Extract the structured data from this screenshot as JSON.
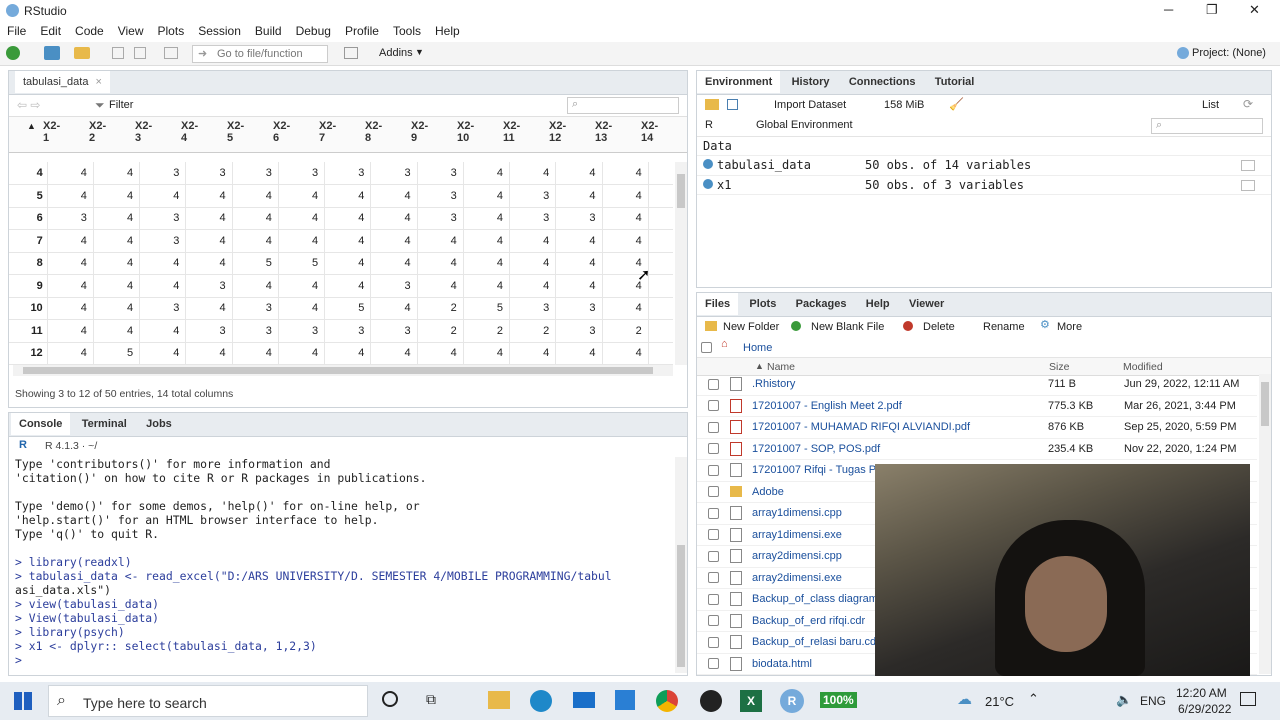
{
  "window": {
    "title": "RStudio",
    "minimize": "─",
    "restore": "❐",
    "close": "✕"
  },
  "menu": [
    "File",
    "Edit",
    "Code",
    "View",
    "Plots",
    "Session",
    "Build",
    "Debug",
    "Profile",
    "Tools",
    "Help"
  ],
  "toolbar": {
    "goto_placeholder": "Go to file/function",
    "addins": "Addins",
    "project": "Project: (None)"
  },
  "source": {
    "tab": "tabulasi_data",
    "filter": "Filter",
    "columns": [
      "X2-\n1",
      "X2-\n2",
      "X2-\n3",
      "X2-\n4",
      "X2-\n5",
      "X2-\n6",
      "X2-\n7",
      "X2-\n8",
      "X2-\n9",
      "X2-\n10",
      "X2-\n11",
      "X2-\n12",
      "X2-\n13",
      "X2-\n14"
    ],
    "rows": [
      {
        "n": "4",
        "v": [
          "4",
          "4",
          "3",
          "3",
          "3",
          "3",
          "3",
          "3",
          "3",
          "4",
          "4",
          "4",
          "4",
          "4"
        ]
      },
      {
        "n": "5",
        "v": [
          "4",
          "4",
          "4",
          "4",
          "4",
          "4",
          "4",
          "4",
          "3",
          "4",
          "3",
          "4",
          "4",
          "3"
        ]
      },
      {
        "n": "6",
        "v": [
          "3",
          "4",
          "3",
          "4",
          "4",
          "4",
          "4",
          "4",
          "3",
          "4",
          "3",
          "3",
          "4",
          "3"
        ]
      },
      {
        "n": "7",
        "v": [
          "4",
          "4",
          "3",
          "4",
          "4",
          "4",
          "4",
          "4",
          "4",
          "4",
          "4",
          "4",
          "4",
          "4"
        ]
      },
      {
        "n": "8",
        "v": [
          "4",
          "4",
          "4",
          "4",
          "5",
          "5",
          "4",
          "4",
          "4",
          "4",
          "4",
          "4",
          "4",
          "4"
        ]
      },
      {
        "n": "9",
        "v": [
          "4",
          "4",
          "4",
          "3",
          "4",
          "4",
          "4",
          "3",
          "4",
          "4",
          "4",
          "4",
          "4",
          "3"
        ]
      },
      {
        "n": "10",
        "v": [
          "4",
          "4",
          "3",
          "4",
          "3",
          "4",
          "5",
          "4",
          "2",
          "5",
          "3",
          "3",
          "4",
          "3"
        ]
      },
      {
        "n": "11",
        "v": [
          "4",
          "4",
          "4",
          "3",
          "3",
          "3",
          "3",
          "3",
          "2",
          "2",
          "2",
          "3",
          "2",
          "3"
        ]
      },
      {
        "n": "12",
        "v": [
          "4",
          "5",
          "4",
          "4",
          "4",
          "4",
          "4",
          "4",
          "4",
          "4",
          "4",
          "4",
          "4",
          "3"
        ]
      }
    ],
    "status": "Showing 3 to 12 of 50 entries, 14 total columns"
  },
  "console": {
    "tabs": [
      "Console",
      "Terminal",
      "Jobs"
    ],
    "version": "R 4.1.3 · ~/",
    "lines": [
      "Type 'contributors()' for more information and",
      "'citation()' on how to cite R or R packages in publications.",
      "",
      "Type 'demo()' for some demos, 'help()' for on-line help, or",
      "'help.start()' for an HTML browser interface to help.",
      "Type 'q()' to quit R.",
      "",
      "> library(readxl)",
      "> tabulasi_data <- read_excel(\"D:/ARS UNIVERSITY/D. SEMESTER 4/MOBILE PROGRAMMING/tabul",
      "asi_data.xls\")",
      "> view(tabulasi_data)",
      "> View(tabulasi_data)",
      "> library(psych)",
      "> x1 <- dplyr:: select(tabulasi_data, 1,2,3)",
      ">"
    ]
  },
  "env": {
    "tabs": [
      "Environment",
      "History",
      "Connections",
      "Tutorial"
    ],
    "import": "Import Dataset",
    "memory": "158 MiB",
    "list": "List",
    "lang": "R",
    "scope": "Global Environment",
    "section": "Data",
    "items": [
      {
        "name": "tabulasi_data",
        "desc": "50 obs. of 14 variables"
      },
      {
        "name": "x1",
        "desc": "50 obs. of 3 variables"
      }
    ]
  },
  "files": {
    "tabs": [
      "Files",
      "Plots",
      "Packages",
      "Help",
      "Viewer"
    ],
    "actions": [
      "New Folder",
      "New Blank File",
      "Delete",
      "Rename",
      "More"
    ],
    "path": "Home",
    "headers": {
      "name": "Name",
      "size": "Size",
      "modified": "Modified"
    },
    "rows": [
      {
        "name": ".Rhistory",
        "size": "711 B",
        "modified": "Jun 29, 2022, 12:11 AM"
      },
      {
        "name": "17201007 - English Meet 2.pdf",
        "size": "775.3 KB",
        "modified": "Mar 26, 2021, 3:44 PM"
      },
      {
        "name": "17201007 - MUHAMAD RIFQI ALVIANDI.pdf",
        "size": "876 KB",
        "modified": "Sep 25, 2020, 5:59 PM"
      },
      {
        "name": "17201007 - SOP, POS.pdf",
        "size": "235.4 KB",
        "modified": "Nov 22, 2020, 1:24 PM"
      },
      {
        "name": "17201007 Rifqi - Tugas P",
        "size": "",
        "modified": ""
      },
      {
        "name": "Adobe",
        "size": "",
        "modified": ""
      },
      {
        "name": "array1dimensi.cpp",
        "size": "",
        "modified": ""
      },
      {
        "name": "array1dimensi.exe",
        "size": "",
        "modified": ""
      },
      {
        "name": "array2dimensi.cpp",
        "size": "",
        "modified": ""
      },
      {
        "name": "array2dimensi.exe",
        "size": "",
        "modified": ""
      },
      {
        "name": "Backup_of_class diagram",
        "size": "",
        "modified": ""
      },
      {
        "name": "Backup_of_erd rifqi.cdr",
        "size": "",
        "modified": ""
      },
      {
        "name": "Backup_of_relasi baru.cdr",
        "size": "",
        "modified": ""
      },
      {
        "name": "biodata.html",
        "size": "",
        "modified": ""
      }
    ]
  },
  "taskbar": {
    "search": "Type here to search",
    "battery": "100%",
    "temp": "21°C",
    "lang": "ENG",
    "time": "12:20 AM",
    "date": "6/29/2022"
  }
}
